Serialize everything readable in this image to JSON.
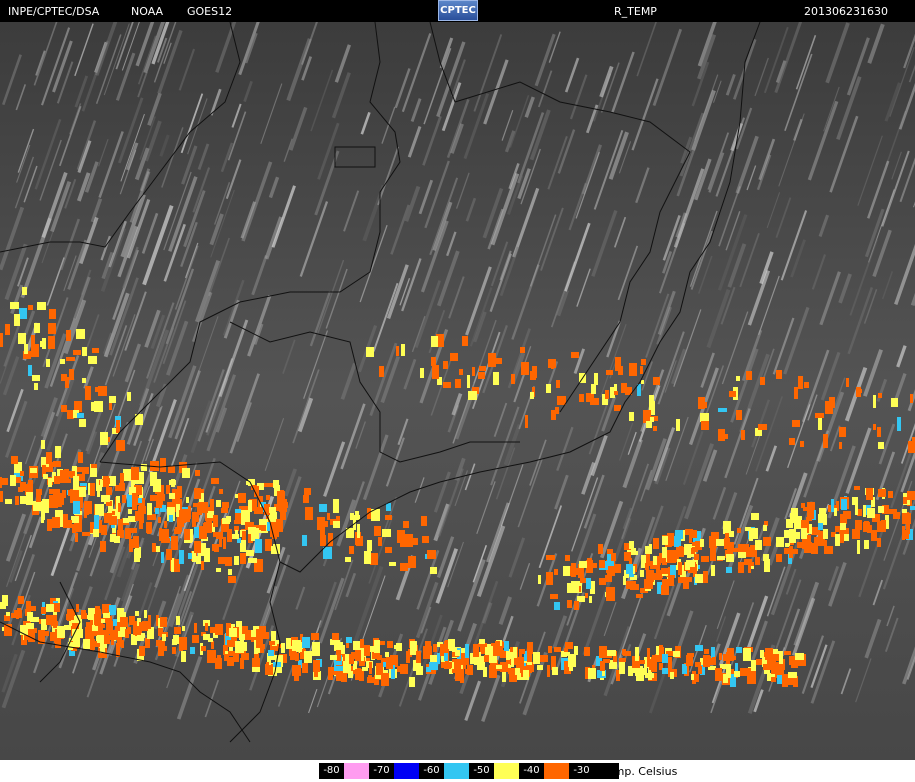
{
  "header": {
    "agency": "INPE/CPTEC/DSA",
    "satellite_owner": "NOAA",
    "satellite": "GOES12",
    "logo_text": "CPTEC",
    "product": "R_TEMP",
    "timestamp": "201306231630"
  },
  "legend": {
    "items": [
      {
        "label": "-80",
        "color": "#ff9cf0"
      },
      {
        "label": "-70",
        "color": "#0000f5"
      },
      {
        "label": "-60",
        "color": "#33c6f2"
      },
      {
        "label": "-50",
        "color": "#ffff55"
      },
      {
        "label": "-40",
        "color": "#ff6600"
      },
      {
        "label": "-30",
        "color": "#000000"
      }
    ],
    "unit": "Temp. Celsius"
  }
}
